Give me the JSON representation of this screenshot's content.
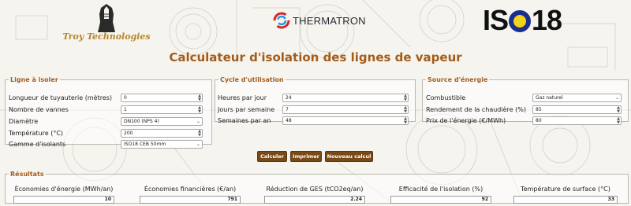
{
  "header": {
    "troy_name": "Troy Technologies",
    "thermatron_name": "THERMATRON",
    "iso_text_left": "IS",
    "iso_text_right": "18",
    "title": "Calculateur d'isolation des lignes de vapeur"
  },
  "colors": {
    "accent": "#a45b1a",
    "button": "#7a4a16",
    "troy_gold": "#b8862a",
    "iso_ring_blue": "#1c2e8c",
    "iso_ring_yellow": "#f2d21b"
  },
  "line": {
    "legend": "Ligne à isoler",
    "fields": [
      {
        "label": "Longueur de tuyauterie (mètres)",
        "value": "0",
        "kind": "number"
      },
      {
        "label": "Nombre de vannes",
        "value": "1",
        "kind": "number"
      },
      {
        "label": "Diamètre",
        "value": "DN100 (NPS 4)",
        "kind": "select"
      },
      {
        "label": "Température (°C)",
        "value": "200",
        "kind": "number"
      },
      {
        "label": "Gamme d'isolants",
        "value": "ISO18 CEB 50mm",
        "kind": "select"
      }
    ]
  },
  "cycle": {
    "legend": "Cycle d'utilisation",
    "fields": [
      {
        "label": "Heures par jour",
        "value": "24",
        "kind": "number"
      },
      {
        "label": "Jours par semaine",
        "value": "7",
        "kind": "number"
      },
      {
        "label": "Semaines par an",
        "value": "48",
        "kind": "number"
      }
    ]
  },
  "energy": {
    "legend": "Source d'énergie",
    "fields": [
      {
        "label": "Combustible",
        "value": "Gaz naturel",
        "kind": "select"
      },
      {
        "label": "Rendement de la chaudière (%)",
        "value": "85",
        "kind": "number"
      },
      {
        "label": "Prix de l'énergie (€/MWh)",
        "value": "80",
        "kind": "number"
      }
    ]
  },
  "buttons": {
    "calculate": "Calculer",
    "print": "Imprimer",
    "new": "Nouveau calcul"
  },
  "results": {
    "legend": "Résultats",
    "items": [
      {
        "label": "Économies d'énergie (MWh/an)",
        "value": "10"
      },
      {
        "label": "Économies financières (€/an)",
        "value": "791"
      },
      {
        "label": "Réduction de GES (tCO2eq/an)",
        "value": "2.24"
      },
      {
        "label": "Efficacité de l'isolation (%)",
        "value": "92"
      },
      {
        "label": "Température de surface (°C)",
        "value": "33"
      }
    ]
  }
}
